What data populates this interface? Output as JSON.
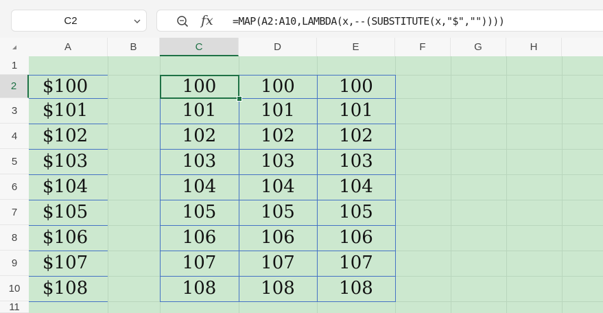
{
  "name_box": {
    "value": "C2"
  },
  "formula_bar": {
    "formula": "=MAP(A2:A10,LAMBDA(x,--(SUBSTITUTE(x,\"$\",\"\"))))",
    "fx_label": "fx"
  },
  "icons": {
    "zoom": "zoom-icon",
    "fx": "function-icon",
    "dropdown": "chevron-down-icon"
  },
  "colors": {
    "cell_fill": "#cce8cf",
    "selection": "#1e7145",
    "range_border": "#4472c4"
  },
  "columns": [
    "A",
    "B",
    "C",
    "D",
    "E",
    "F",
    "G",
    "H"
  ],
  "rows": [
    "1",
    "2",
    "3",
    "4",
    "5",
    "6",
    "7",
    "8",
    "9",
    "10",
    "11"
  ],
  "selected_cell": {
    "column": "C",
    "row": "2"
  },
  "data": {
    "A": [
      "$100",
      "$101",
      "$102",
      "$103",
      "$104",
      "$105",
      "$106",
      "$107",
      "$108"
    ],
    "C": [
      "100",
      "101",
      "102",
      "103",
      "104",
      "105",
      "106",
      "107",
      "108"
    ],
    "D": [
      "100",
      "101",
      "102",
      "103",
      "104",
      "105",
      "106",
      "107",
      "108"
    ],
    "E": [
      "100",
      "101",
      "102",
      "103",
      "104",
      "105",
      "106",
      "107",
      "108"
    ]
  }
}
